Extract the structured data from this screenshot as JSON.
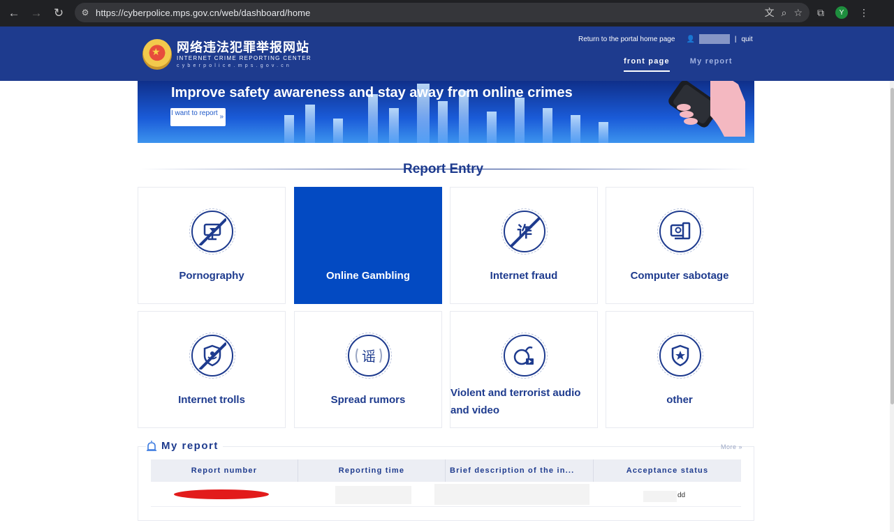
{
  "browser": {
    "url": "https://cyberpolice.mps.gov.cn/web/dashboard/home",
    "avatar_letter": "Y"
  },
  "header": {
    "title_cn": "网络违法犯罪举报网站",
    "subtitle": "INTERNET CRIME REPORTING CENTER",
    "domain": "cyberpolice.mps.gov.cn",
    "portal_link": "Return to the portal home page",
    "separator": "|",
    "quit": "quit",
    "nav": [
      {
        "label": "front page",
        "active": true
      },
      {
        "label": "My report",
        "active": false
      }
    ]
  },
  "banner": {
    "headline": "Improve safety awareness and stay away from online crimes",
    "button": "I want to report",
    "button_chevron": "»"
  },
  "entry": {
    "title": "Report Entry",
    "items": [
      {
        "label": "Pornography",
        "icon": "monitor-icon"
      },
      {
        "label": "Online Gambling",
        "icon": "gambling-icon",
        "active": true
      },
      {
        "label": "Internet fraud",
        "icon": "fraud-icon",
        "glyph": "诈"
      },
      {
        "label": "Computer sabotage",
        "icon": "computer-gear-icon"
      },
      {
        "label": "Internet trolls",
        "icon": "shield-hand-icon"
      },
      {
        "label": "Spread rumors",
        "icon": "rumor-icon",
        "glyph": "谣"
      },
      {
        "label": "Violent and terrorist audio and video",
        "icon": "bomb-video-icon"
      },
      {
        "label": "other",
        "icon": "shield-star-icon"
      }
    ]
  },
  "my_report": {
    "title": "My report",
    "more": "More »",
    "columns": [
      "Report number",
      "Reporting time",
      "Brief description of the in...",
      "Acceptance status"
    ],
    "rows": [
      {
        "status": "dd"
      }
    ]
  }
}
